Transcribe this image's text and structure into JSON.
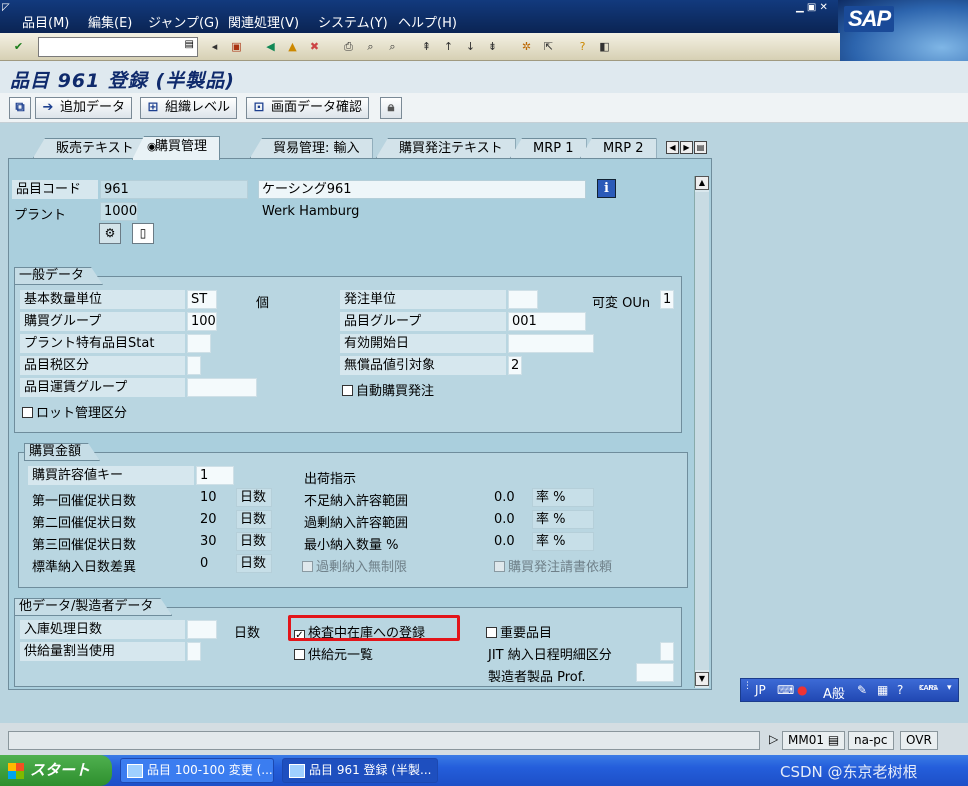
{
  "menu": {
    "items": [
      "品目(M)",
      "編集(E)",
      "ジャンプ(G)",
      "関連処理(V)",
      "システム(Y)",
      "ヘルプ(H)"
    ]
  },
  "logo": "SAP",
  "title": "品目 961 登録 (半製品)",
  "appbar": {
    "buttons": [
      "追加データ",
      "組織レベル",
      "画面データ確認"
    ]
  },
  "tabs": [
    "販売テキスト",
    "購買管理",
    "貿易管理: 輸入",
    "購買発注テキスト",
    "MRP 1",
    "MRP 2"
  ],
  "header": {
    "material_label": "品目コード",
    "material_value": "961",
    "material_desc": "ケーシング961",
    "plant_label": "プラント",
    "plant_value": "1000",
    "plant_desc": "Werk Hamburg"
  },
  "general": {
    "title": "一般データ",
    "base_uom_label": "基本数量単位",
    "base_uom": "ST",
    "base_uom_unit": "個",
    "order_unit_label": "発注単位",
    "order_unit": "",
    "var_oun_label": "可変 OUn",
    "var_oun": "1",
    "purch_group_label": "購買グループ",
    "purch_group": "100",
    "mat_group_label": "品目グループ",
    "mat_group": "001",
    "plant_status_label": "プラント特有品目Stat",
    "valid_from_label": "有効開始日",
    "tax_label": "品目税区分",
    "discount_label": "無償品値引対象",
    "discount": "2",
    "freight_label": "品目運賃グループ",
    "auto_po_label": "自動購買発注",
    "batch_label": "ロット管理区分"
  },
  "purch_values": {
    "title": "購買金額",
    "tol_key_label": "購買許容値キー",
    "tol_key": "1",
    "reminder1_label": "第一回催促状日数",
    "reminder1": "10",
    "reminder2_label": "第二回催促状日数",
    "reminder2": "20",
    "reminder3_label": "第三回催促状日数",
    "reminder3": "30",
    "std_dev_label": "標準納入日数差異",
    "std_dev": "0",
    "days_unit": "日数",
    "ship_instr_label": "出荷指示",
    "under_tol_label": "不足納入許容範囲",
    "under_tol": "0.0",
    "over_tol_label": "過剰納入許容範囲",
    "over_tol": "0.0",
    "min_qty_label": "最小納入数量 %",
    "min_qty": "0.0",
    "pct_unit": "率 %",
    "unlimited_label": "過剰納入無制限",
    "ack_label": "購買発注請書依頼"
  },
  "other": {
    "title": "他データ/製造者データ",
    "gr_time_label": "入庫処理日数",
    "gr_time_unit": "日数",
    "qi_label": "検査中在庫への登録",
    "critical_label": "重要品目",
    "quota_label": "供給量割当使用",
    "source_list_label": "供給元一覧",
    "jit_label": "JIT 納入日程明細区分",
    "mfr_prof_label": "製造者製品 Prof."
  },
  "status": {
    "transaction": "MM01",
    "server": "na-pc",
    "mode": "OVR"
  },
  "ime": {
    "lang": "JP",
    "caps": "CAPS",
    "kana": "KANA"
  },
  "taskbar": {
    "start": "スタート",
    "tasks": [
      "品目 100-100 変更 (...",
      "品目 961 登録 (半製..."
    ]
  },
  "watermark": "CSDN @东京老树根"
}
